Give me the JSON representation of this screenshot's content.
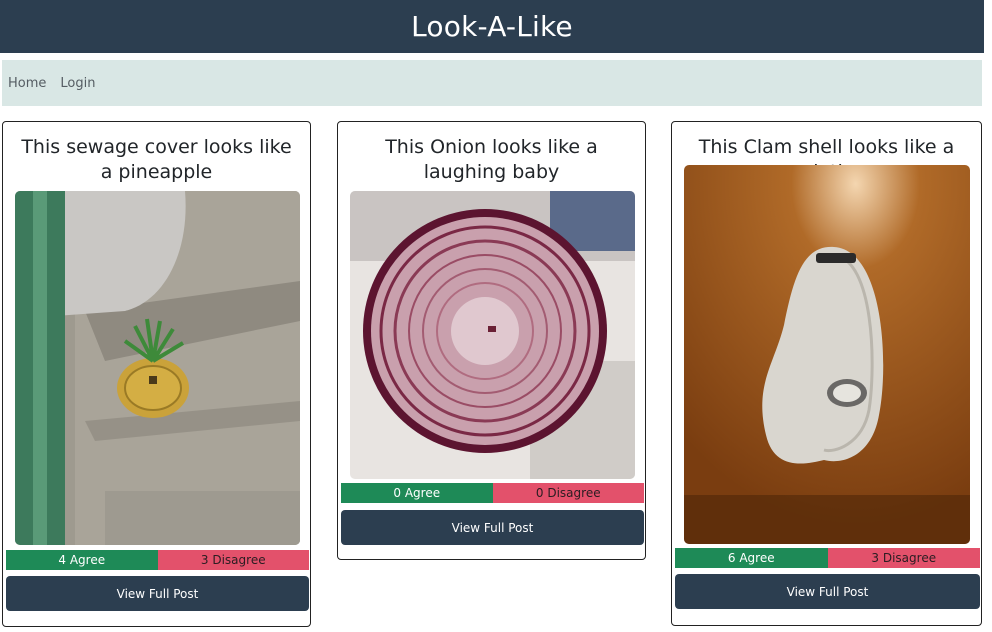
{
  "header": {
    "title": "Look-A-Like"
  },
  "nav": {
    "items": [
      {
        "label": "Home"
      },
      {
        "label": "Login"
      }
    ]
  },
  "posts": [
    {
      "title": "This sewage cover looks like a pineapple",
      "agree": "4 Agree",
      "disagree": "3 Disagree",
      "button": "View Full Post",
      "image": "sewage-cover-photo"
    },
    {
      "title": "This Onion looks like a laughing baby",
      "agree": "0 Agree",
      "disagree": "0 Disagree",
      "button": "View Full Post",
      "image": "onion-photo"
    },
    {
      "title": "This Clam shell looks like a sloth",
      "agree": "6 Agree",
      "disagree": "3 Disagree",
      "button": "View Full Post",
      "image": "clam-shell-photo"
    }
  ],
  "colors": {
    "header": "#2c3e50",
    "nav": "#d9e7e5",
    "agree": "#1e8a57",
    "disagree": "#e3516b",
    "button": "#2c3e50"
  }
}
